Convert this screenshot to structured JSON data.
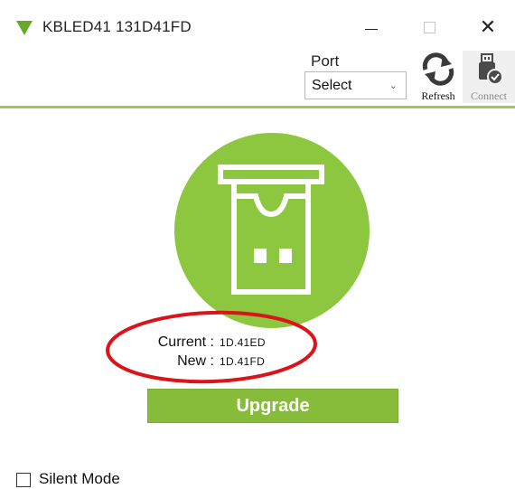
{
  "window": {
    "title": "KBLED41 131D41FD",
    "minimize_symbol": "—",
    "close_symbol": "✕"
  },
  "toolbar": {
    "port_label": "Port",
    "port_select_value": "Select",
    "refresh_label": "Refresh",
    "connect_label": "Connect",
    "connect_enabled": false
  },
  "versions": {
    "current_label": "Current :",
    "current_value": "1D.41ED",
    "new_label": "New :",
    "new_value": "1D.41FD"
  },
  "actions": {
    "upgrade_label": "Upgrade"
  },
  "options": {
    "silent_mode_label": "Silent Mode",
    "silent_mode_checked": false
  },
  "icons": {
    "app": "green-triangle-logo-icon",
    "refresh": "refresh-icon",
    "connect": "usb-connect-icon",
    "device": "usb-device-icon"
  },
  "colors": {
    "brand_green": "#86bc3a",
    "circle_green": "#8dc63f",
    "divider_green": "#9cc95e",
    "annotation_red": "#d9141b"
  }
}
